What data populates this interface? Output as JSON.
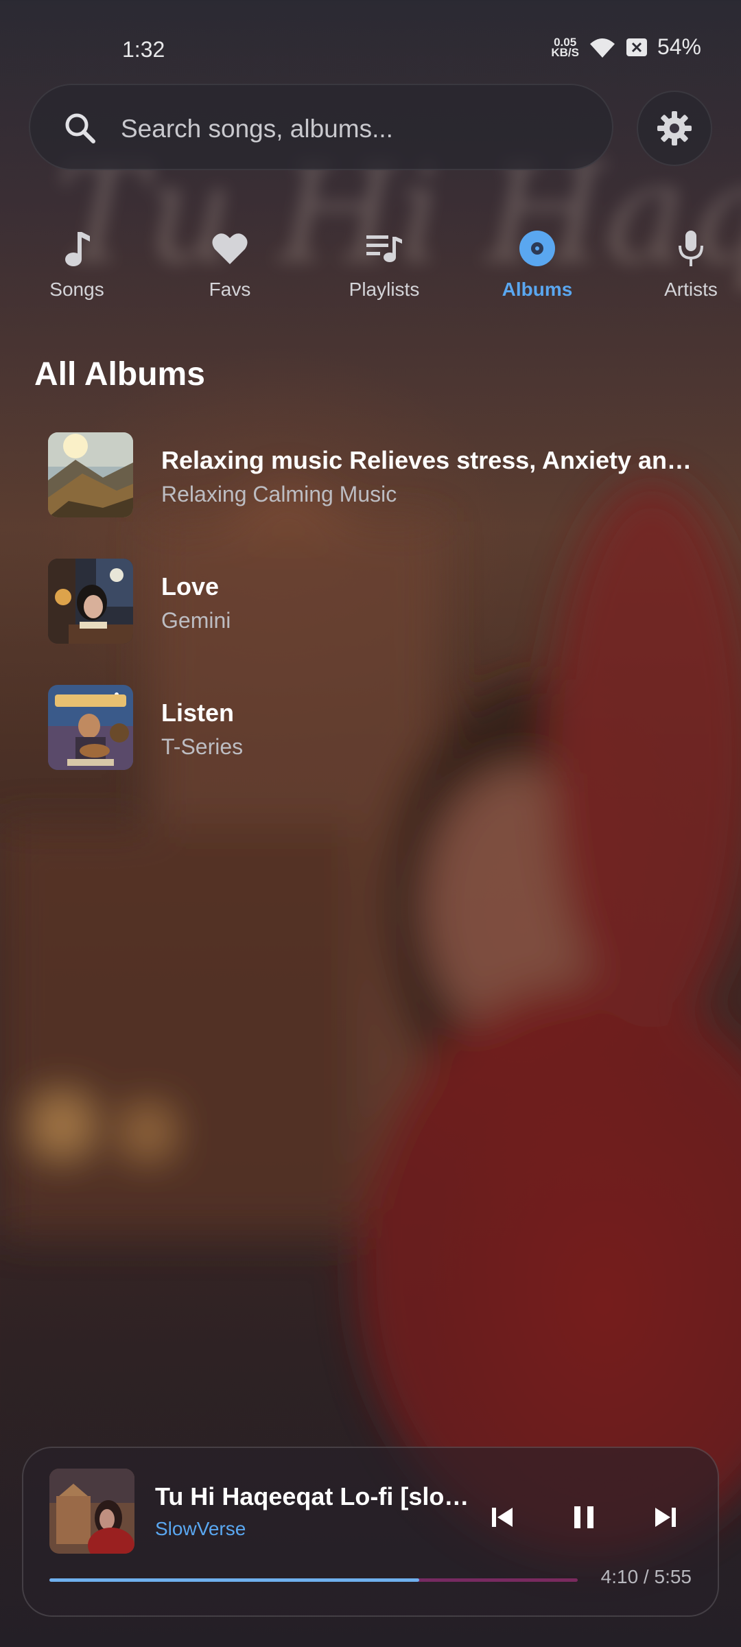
{
  "status_bar": {
    "time": "1:32",
    "net_speed_value": "0.05",
    "net_speed_unit": "KB/S",
    "battery": "54%"
  },
  "search": {
    "placeholder": "Search songs, albums...",
    "value": ""
  },
  "tabs": [
    {
      "label": "Songs",
      "icon": "music-note-icon",
      "active": false
    },
    {
      "label": "Favs",
      "icon": "heart-icon",
      "active": false
    },
    {
      "label": "Playlists",
      "icon": "playlist-icon",
      "active": false
    },
    {
      "label": "Albums",
      "icon": "album-disc-icon",
      "active": true
    },
    {
      "label": "Artists",
      "icon": "microphone-icon",
      "active": false
    }
  ],
  "section_title": "All Albums",
  "albums": [
    {
      "title": "Relaxing music Relieves stress, Anxiety an…",
      "artist": "Relaxing Calming Music"
    },
    {
      "title": "Love",
      "artist": "Gemini"
    },
    {
      "title": "Listen",
      "artist": "T-Series"
    }
  ],
  "now_playing": {
    "title": "Tu Hi Haqeeqat Lo-fi [slo…",
    "artist": "SlowVerse",
    "time": "4:10 / 5:55",
    "progress": 0.7
  },
  "colors": {
    "accent": "#5aa7f0",
    "progress_fill": "#6fb0ee",
    "progress_track": "#6b2c6a"
  }
}
